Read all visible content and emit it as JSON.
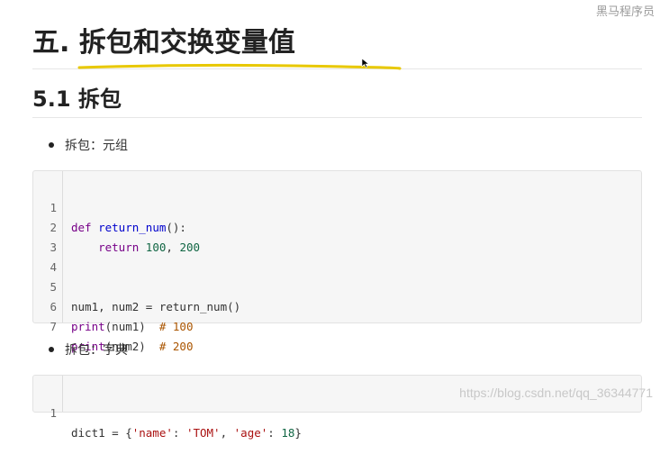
{
  "watermark_top": "黑马程序员",
  "watermark_bottom": "https://blog.csdn.net/qq_36344771",
  "heading1": "五. 拆包和交换变量值",
  "heading2": "5.1 拆包",
  "bullets": [
    "拆包：元组",
    "拆包：字典"
  ],
  "code_block_1": {
    "lines": [
      {
        "n": "1"
      },
      {
        "n": "2"
      },
      {
        "n": "3"
      },
      {
        "n": "4"
      },
      {
        "n": "5"
      },
      {
        "n": "6"
      },
      {
        "n": "7"
      }
    ],
    "tokens": {
      "l1_def": "def",
      "l1_fn": "return_num",
      "l1_rest": "():",
      "l2_indent": "    ",
      "l2_kw": "return",
      "l2_n1": "100",
      "l2_sep": ", ",
      "l2_n2": "200",
      "l5": "num1, num2 = return_num()",
      "l6_kw": "print",
      "l6_rest": "(num1)  ",
      "l6_cm": "# 100",
      "l7_kw": "print",
      "l7_rest": "(num2)  ",
      "l7_cm": "# 200"
    }
  },
  "code_block_2": {
    "lines": [
      {
        "n": "1"
      }
    ],
    "tokens": {
      "a": "dict1 = {",
      "s1": "'name'",
      "b": ": ",
      "s2": "'TOM'",
      "c": ", ",
      "s3": "'age'",
      "d": ": ",
      "n": "18",
      "e": "}"
    }
  },
  "colors": {
    "keyword": "#770088",
    "function": "#0000cc",
    "number": "#116644",
    "string": "#aa1111",
    "comment": "#aa5500",
    "highlight_stroke": "#e8c800"
  }
}
